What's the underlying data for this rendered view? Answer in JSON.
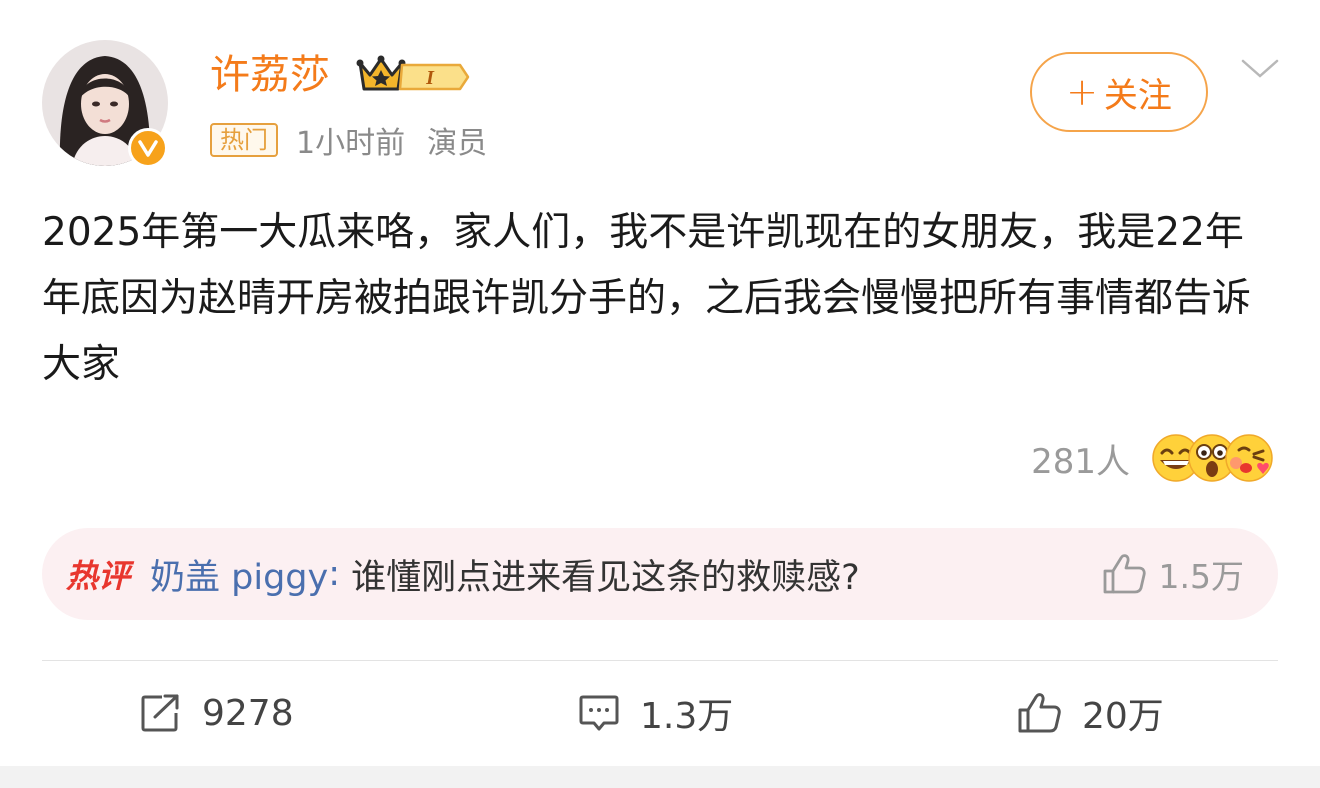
{
  "post": {
    "author": {
      "name": "许荔莎",
      "level": "I",
      "tag": "热门",
      "time": "1小时前",
      "role": "演员"
    },
    "follow_label": "关注",
    "content": "2025年第一大瓜来咯，家人们，我不是许凯现在的女朋友，我是22年年底因为赵晴开房被拍跟许凯分手的，之后我会慢慢把所有事情都告诉大家",
    "reactions": {
      "count": "281人",
      "icons": [
        "grin-emoji-icon",
        "shocked-emoji-icon",
        "kiss-emoji-icon"
      ]
    },
    "hot_comment": {
      "label": "热评",
      "user": "奶盖 piggy",
      "separator": ": ",
      "text": "谁懂刚点进来看见这条的救赎感?",
      "likes": "1.5万"
    },
    "actions": {
      "repost": "9278",
      "comment": "1.3万",
      "like": "20万"
    }
  },
  "colors": {
    "accent": "#f47b1a",
    "link": "#4a6fae",
    "hot_red": "#e8362e",
    "hot_bg": "#fcf0f2"
  }
}
